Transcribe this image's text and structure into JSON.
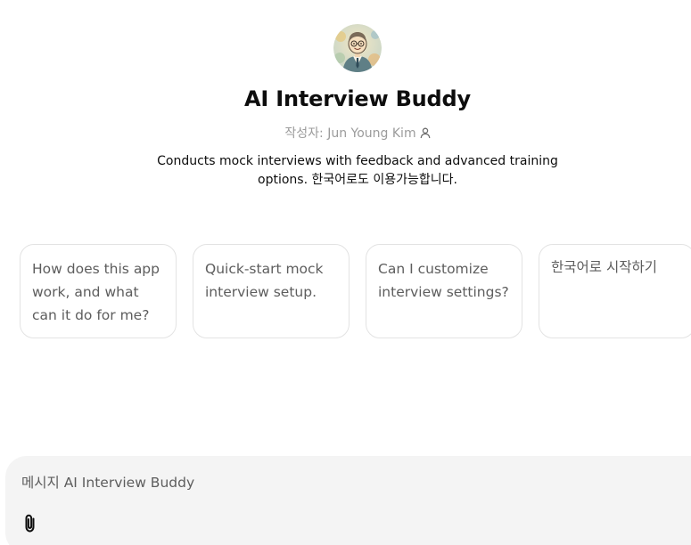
{
  "gpt": {
    "title": "AI Interview Buddy",
    "author": "작성자: Jun Young Kim",
    "description": "Conducts mock interviews with feedback and advanced training options. 한국어로도 이용가능합니다.",
    "avatar_icon": "cartoon-man-in-suit-avatar"
  },
  "starters": [
    {
      "label": "How does this app work, and what can it do for me?"
    },
    {
      "label": "Quick-start mock interview setup."
    },
    {
      "label": "Can I customize interview settings?"
    },
    {
      "label": "한국어로 시작하기"
    }
  ],
  "composer": {
    "placeholder": "메시지 AI Interview Buddy",
    "attach_icon": "paperclip-icon"
  }
}
